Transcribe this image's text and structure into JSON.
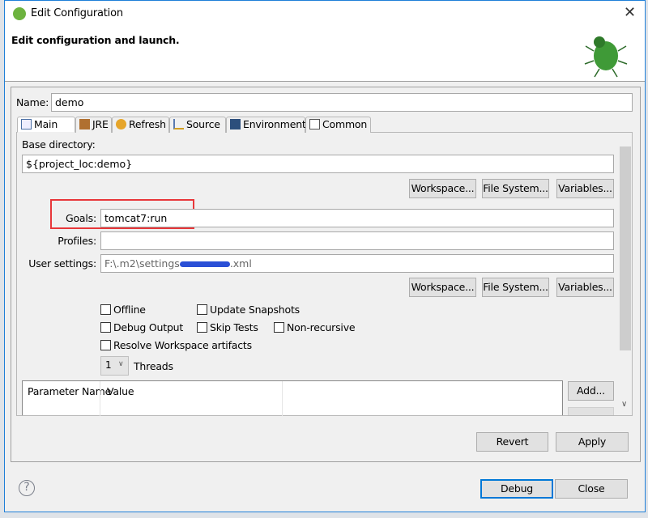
{
  "window": {
    "title": "Edit Configuration",
    "close_icon": "close-icon"
  },
  "header": {
    "title": "Edit configuration and launch.",
    "icon": "bug-icon"
  },
  "name": {
    "label": "Name:",
    "value": "demo"
  },
  "tabs": [
    {
      "label": "Main",
      "active": true
    },
    {
      "label": "JRE"
    },
    {
      "label": "Refresh"
    },
    {
      "label": "Source"
    },
    {
      "label": "Environment"
    },
    {
      "label": "Common"
    }
  ],
  "main": {
    "base_dir_label": "Base directory:",
    "base_dir_value": "${project_loc:demo}",
    "buttons1": [
      "Workspace...",
      "File System...",
      "Variables..."
    ],
    "goals_label": "Goals:",
    "goals_value": "tomcat7:run",
    "profiles_label": "Profiles:",
    "profiles_value": "",
    "user_settings_label": "User settings:",
    "user_settings_value": "F:\\.m2\\settings",
    "user_settings_suffix": ".xml",
    "buttons2": [
      "Workspace...",
      "File System...",
      "Variables..."
    ],
    "checkboxes": {
      "offline": "Offline",
      "update_snapshots": "Update Snapshots",
      "debug_output": "Debug Output",
      "skip_tests": "Skip Tests",
      "non_recursive": "Non-recursive",
      "resolve_workspace": "Resolve Workspace artifacts"
    },
    "threads_value": "1",
    "threads_label": "Threads",
    "table_headers": [
      "Parameter Name",
      "Value"
    ],
    "add_button": "Add..."
  },
  "actions": {
    "revert": "Revert",
    "apply": "Apply",
    "debug": "Debug",
    "close": "Close"
  },
  "highlight_color": "#e8373a"
}
